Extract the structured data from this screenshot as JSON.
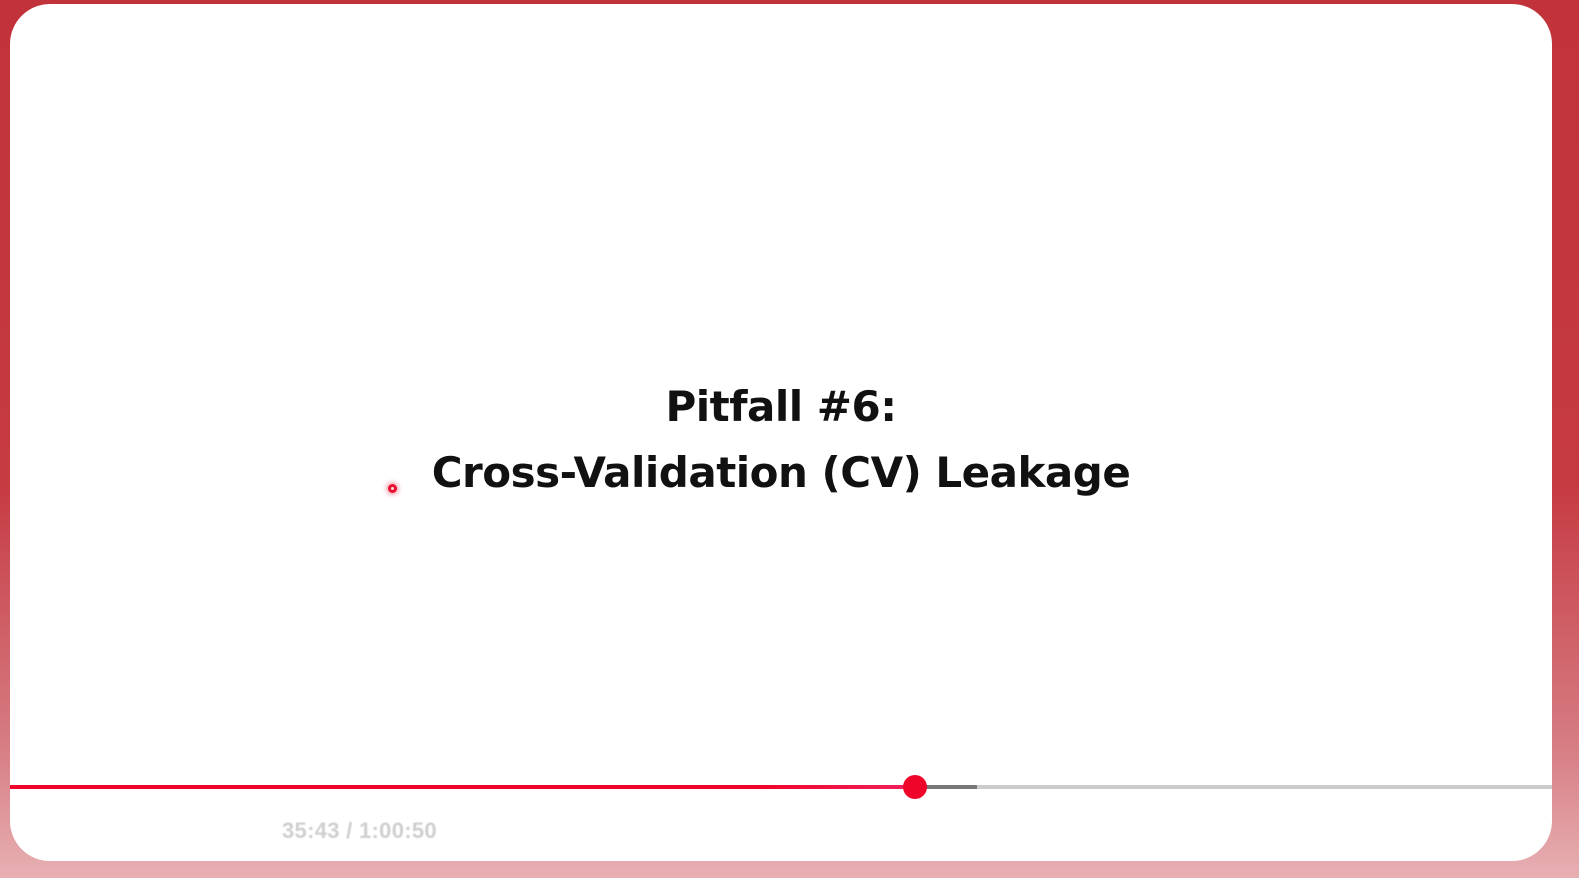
{
  "slide": {
    "title_line1": "Pitfall #6:",
    "title_line2": "Cross-Validation (CV) Leakage"
  },
  "player": {
    "current_time": "35:43",
    "duration": "1:00:50",
    "time_display": "35:43 / 1:00:50",
    "progress_fraction": 0.587,
    "buffered_fraction": 0.627
  },
  "colors": {
    "accent": "#f0052a",
    "frame_border": "#c1323a",
    "track": "#cccccc",
    "buffer": "#777777"
  },
  "icons": {
    "laser_pointer": "laser-pointer-dot"
  }
}
